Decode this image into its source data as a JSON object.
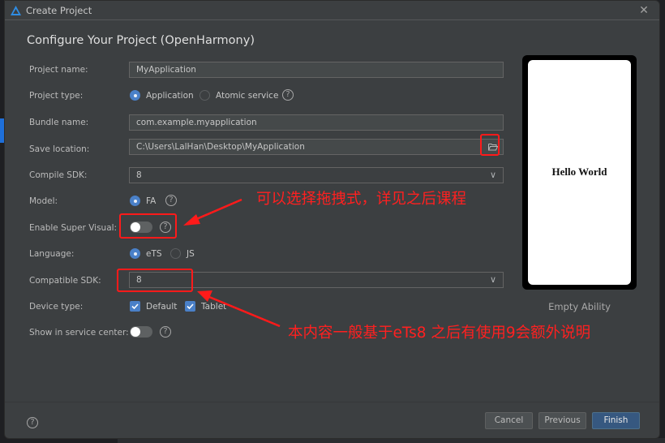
{
  "window": {
    "title": "Create Project",
    "close_icon": "close-icon",
    "app_icon": "deveco-logo-icon"
  },
  "heading": "Configure Your Project (OpenHarmony)",
  "form": {
    "project_name": {
      "label": "Project name:",
      "value": "MyApplication"
    },
    "project_type": {
      "label": "Project type:",
      "options": [
        {
          "label": "Application",
          "selected": true
        },
        {
          "label": "Atomic service",
          "selected": false
        }
      ],
      "help": "?"
    },
    "bundle_name": {
      "label": "Bundle name:",
      "value": "com.example.myapplication"
    },
    "save_location": {
      "label": "Save location:",
      "value": "C:\\Users\\LalHan\\Desktop\\MyApplication",
      "browse_icon": "folder-open-icon"
    },
    "compile_sdk": {
      "label": "Compile SDK:",
      "value": "8"
    },
    "model": {
      "label": "Model:",
      "options": [
        {
          "label": "FA",
          "selected": true
        }
      ],
      "help": "?"
    },
    "super_visual": {
      "label": "Enable Super Visual:",
      "enabled": false,
      "help": "?"
    },
    "language": {
      "label": "Language:",
      "options": [
        {
          "label": "eTS",
          "selected": true
        },
        {
          "label": "JS",
          "selected": false
        }
      ]
    },
    "compatible_sdk": {
      "label": "Compatible SDK:",
      "value": "8"
    },
    "device_type": {
      "label": "Device type:",
      "options": [
        {
          "label": "Default",
          "checked": true
        },
        {
          "label": "Tablet",
          "checked": true
        }
      ]
    },
    "service_center": {
      "label": "Show in service center:",
      "enabled": false,
      "help": "?"
    }
  },
  "preview": {
    "screen_text": "Hello World",
    "template_name": "Empty Ability"
  },
  "footer": {
    "help": "?",
    "cancel": "Cancel",
    "previous": "Previous",
    "finish": "Finish"
  },
  "annotations": {
    "super_visual_note": "可以选择拖拽式，详见之后课程",
    "sdk_note": "本内容一般基于eTs8 之后有使用9会额外说明",
    "color": "#ff1a1a"
  },
  "colors": {
    "dialog_bg": "#3c3f41",
    "accent": "#4a80c8",
    "primary_button": "#365880"
  }
}
